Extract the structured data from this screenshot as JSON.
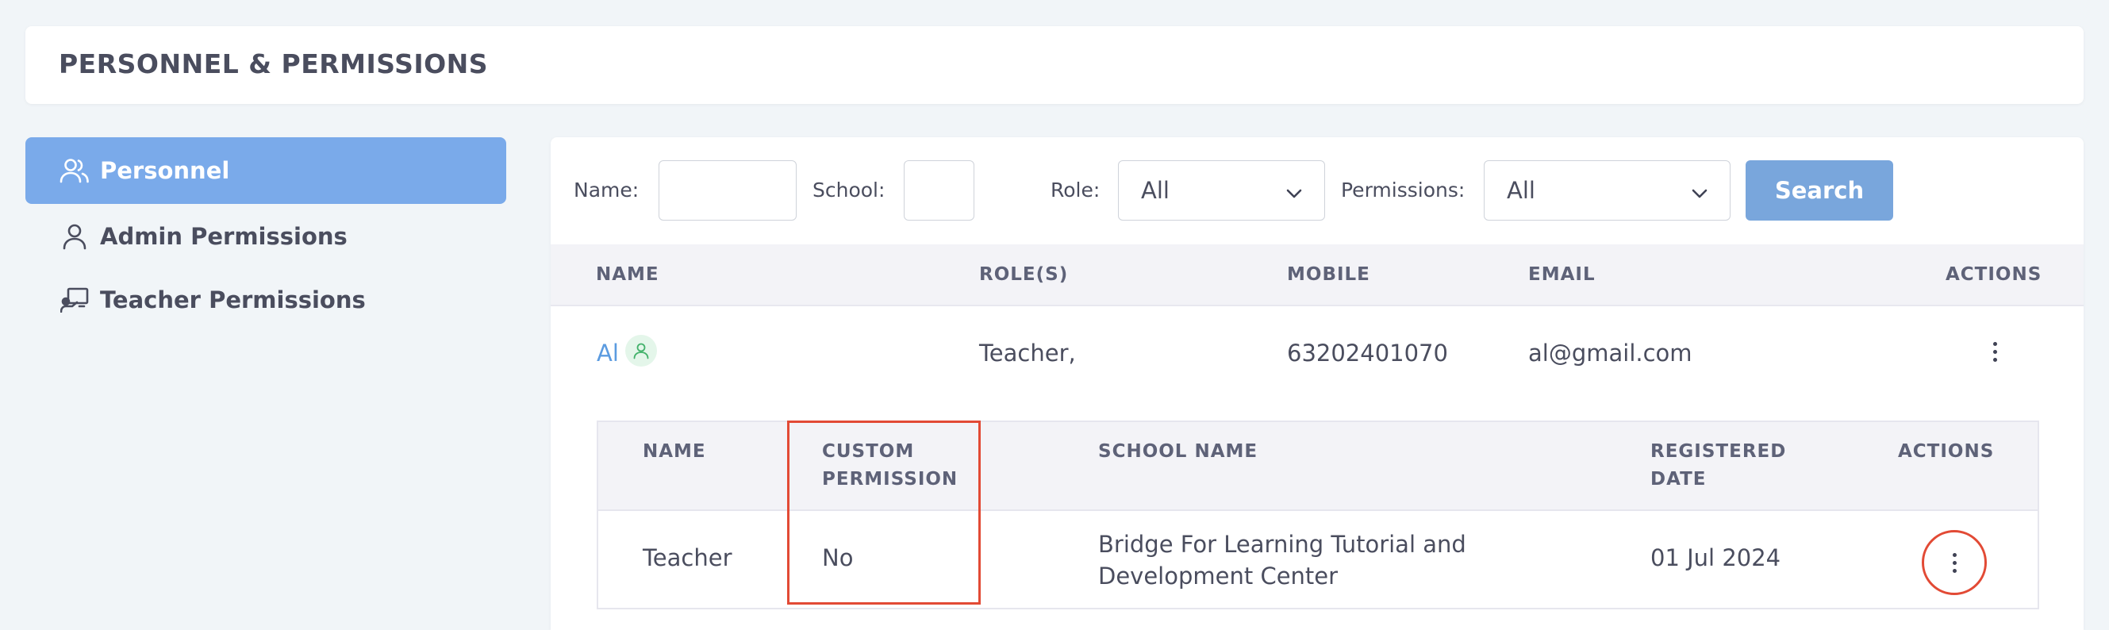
{
  "header": {
    "title": "PERSONNEL & PERMISSIONS"
  },
  "sidebar": {
    "items": [
      {
        "label": "Personnel",
        "icon": "users-icon",
        "active": true
      },
      {
        "label": "Admin Permissions",
        "icon": "user-icon",
        "active": false
      },
      {
        "label": "Teacher Permissions",
        "icon": "teacher-board-icon",
        "active": false
      }
    ]
  },
  "filters": {
    "name_label": "Name:",
    "name_value": "",
    "school_label": "School:",
    "school_value": "",
    "role_label": "Role:",
    "role_selected": "All",
    "permissions_label": "Permissions:",
    "permissions_selected": "All",
    "search_label": "Search"
  },
  "table": {
    "columns": [
      "NAME",
      "ROLE(S)",
      "MOBILE",
      "EMAIL",
      "ACTIONS"
    ],
    "rows": [
      {
        "name": "Al",
        "roles": "Teacher,",
        "mobile": "63202401070",
        "email": "al@gmail.com"
      }
    ]
  },
  "subtable": {
    "columns": [
      "NAME",
      "CUSTOM PERMISSION",
      "SCHOOL NAME",
      "REGISTERED DATE",
      "ACTIONS"
    ],
    "col_lines": {
      "custom_1": "CUSTOM",
      "custom_2": "PERMISSION",
      "registered_1": "REGISTERED",
      "registered_2": "DATE"
    },
    "rows": [
      {
        "name": "Teacher",
        "custom_permission": "No",
        "school_line1": "Bridge For Learning Tutorial and",
        "school_line2": "Development Center",
        "registered_date": "01 Jul 2024"
      }
    ]
  },
  "colors": {
    "accent": "#7aaaea",
    "search_button": "#79a6dc",
    "link": "#5b9be0",
    "highlight": "#e24a35"
  }
}
